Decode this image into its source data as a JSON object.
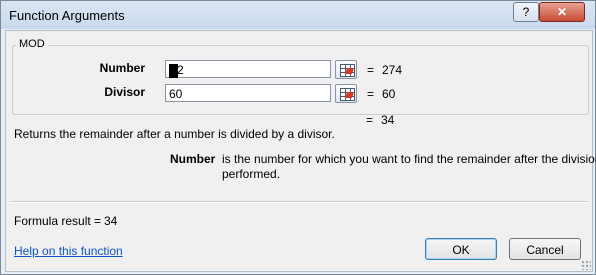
{
  "window": {
    "title": "Function Arguments",
    "help_glyph": "?",
    "close_glyph": "✕"
  },
  "function_group": {
    "name": "MOD"
  },
  "args": [
    {
      "label": "Number",
      "value": "2",
      "result": "274"
    },
    {
      "label": "Divisor",
      "value": "60",
      "result": "60"
    }
  ],
  "equals": "=",
  "overall_result": "34",
  "function_description": "Returns the remainder after a number is divided by a divisor.",
  "arg_help": {
    "name": "Number",
    "text": "is the number for which you want to find the remainder after the division is performed."
  },
  "formula_result": {
    "label": "Formula result =",
    "value": "34"
  },
  "footer": {
    "help_link": "Help on this function",
    "ok_label": "OK",
    "cancel_label": "Cancel"
  },
  "colors": {
    "link": "#0b55c4",
    "close_button": "#c74b33",
    "ref_arrow": "#d23b2b"
  }
}
